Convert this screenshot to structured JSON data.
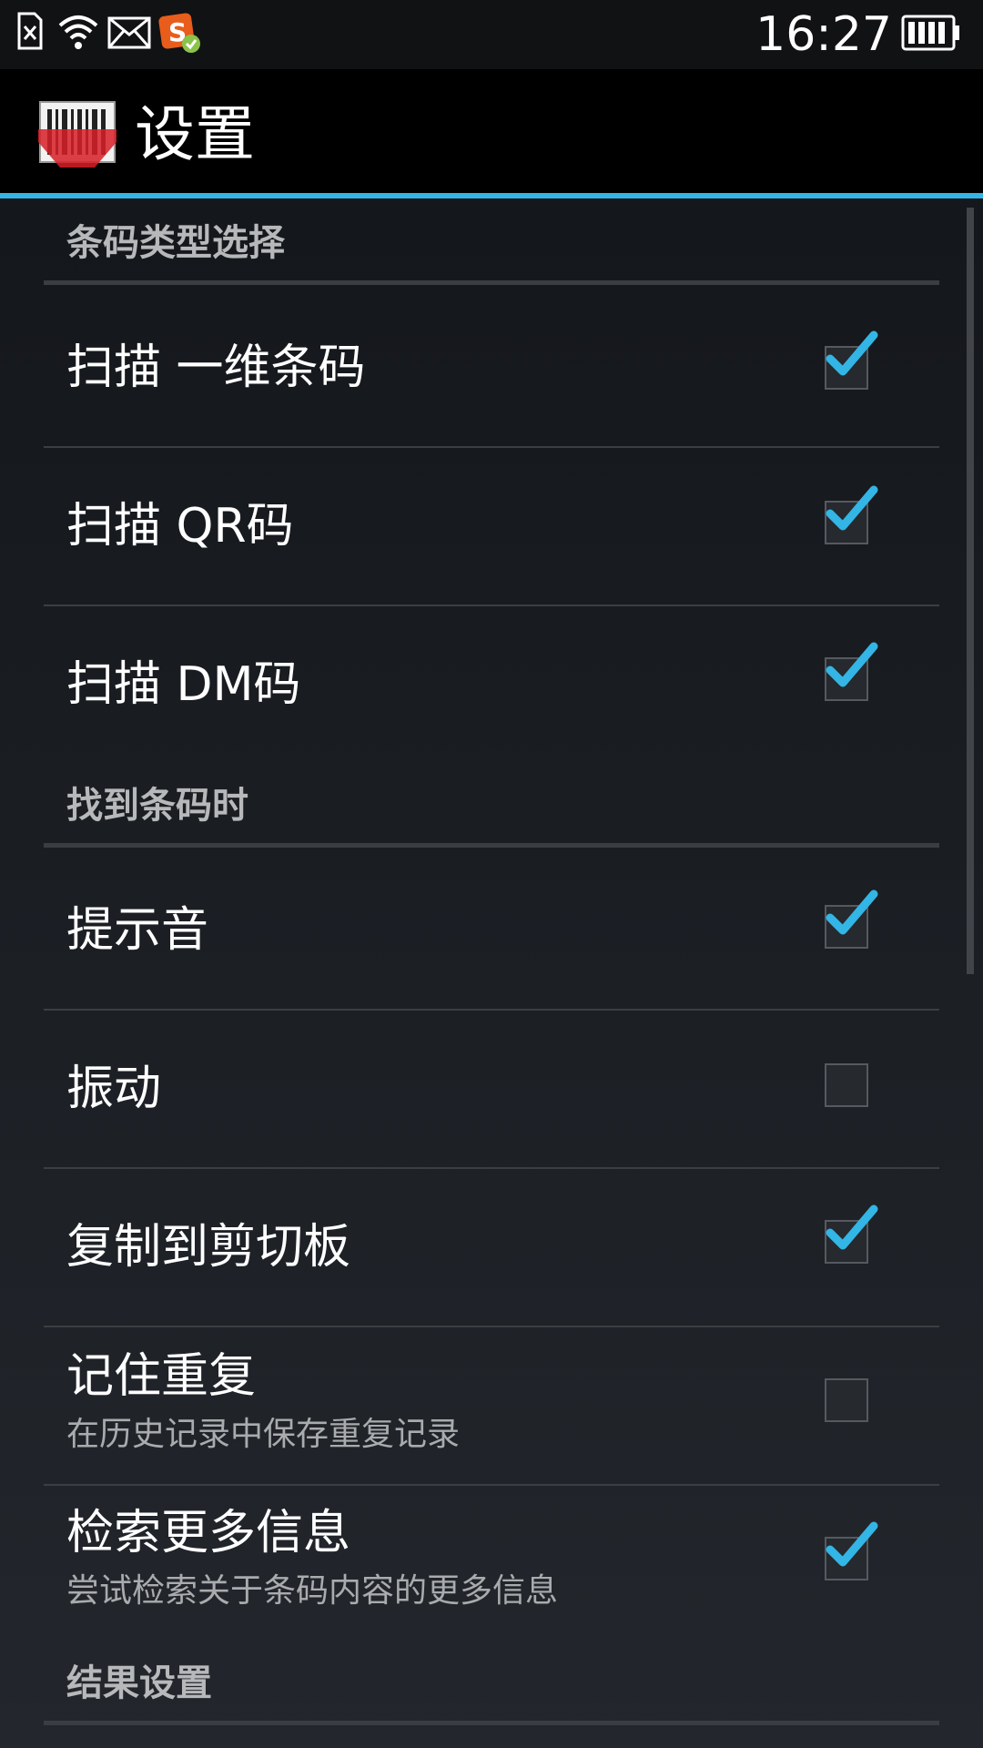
{
  "status_bar": {
    "time": "16:27",
    "icons": [
      "sim-error-icon",
      "wifi-icon",
      "mail-icon",
      "sogou-input-icon",
      "battery-icon"
    ]
  },
  "action_bar": {
    "title": "设置",
    "logo": "barcode-scanner-icon"
  },
  "colors": {
    "accent": "#33b5e5",
    "background": "#1b1f24"
  },
  "categories": [
    {
      "label": "条码类型选择"
    },
    {
      "label": "找到条码时"
    },
    {
      "label": "结果设置"
    }
  ],
  "prefs": [
    {
      "title": "扫描 一维条码",
      "checked": true
    },
    {
      "title": "扫描 QR码",
      "checked": true
    },
    {
      "title": "扫描 DM码",
      "checked": true
    },
    {
      "title": "提示音",
      "checked": true
    },
    {
      "title": "振动",
      "checked": false
    },
    {
      "title": "复制到剪切板",
      "checked": true
    },
    {
      "title": "记住重复",
      "summary": "在历史记录中保存重复记录",
      "checked": false
    },
    {
      "title": "检索更多信息",
      "summary": "尝试检索关于条码内容的更多信息",
      "checked": true
    }
  ]
}
